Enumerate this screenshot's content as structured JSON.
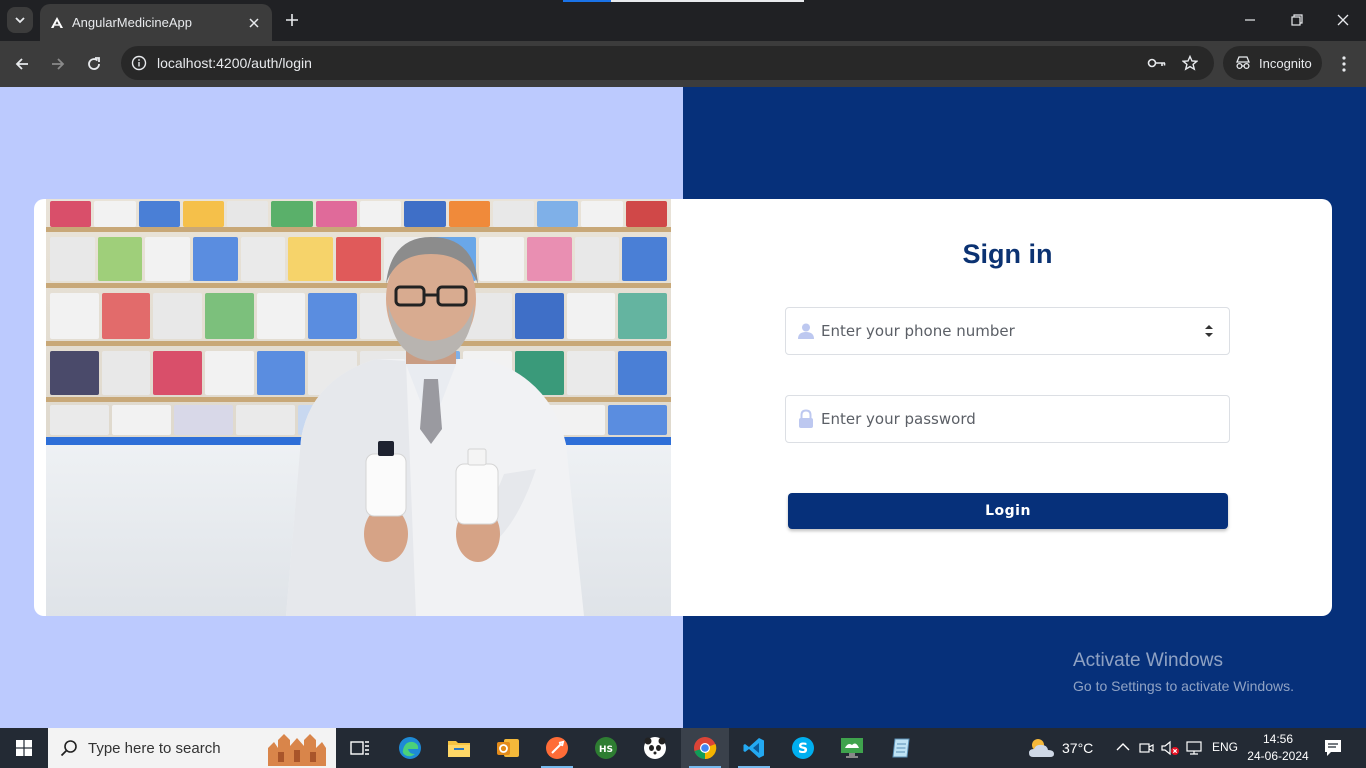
{
  "browser": {
    "tab_title": "AngularMedicineApp",
    "url": "localhost:4200/auth/login",
    "incognito_label": "Incognito"
  },
  "login": {
    "title": "Sign in",
    "phone_placeholder": "Enter your phone number",
    "password_placeholder": "Enter your password",
    "login_label": "Login"
  },
  "watermark": {
    "title": "Activate Windows",
    "subtitle": "Go to Settings to activate Windows."
  },
  "taskbar": {
    "search_placeholder": "Type here to search",
    "weather_temp": "37°C",
    "language": "ENG",
    "time": "14:56",
    "date": "24-06-2024"
  },
  "colors": {
    "left_bg": "#bccafe",
    "right_bg": "#06307a",
    "accent": "#0b3272"
  },
  "icons": [
    "angular-icon",
    "user-icon",
    "lock-icon",
    "windows-start-icon",
    "search-icon",
    "task-view-icon",
    "edge-icon",
    "file-explorer-icon",
    "outlook-icon",
    "postman-icon",
    "hubstaff-icon",
    "panda-icon",
    "chrome-icon",
    "vscode-icon",
    "skype-icon",
    "remote-desktop-icon",
    "notepad-icon",
    "weather-icon",
    "notification-icon"
  ]
}
